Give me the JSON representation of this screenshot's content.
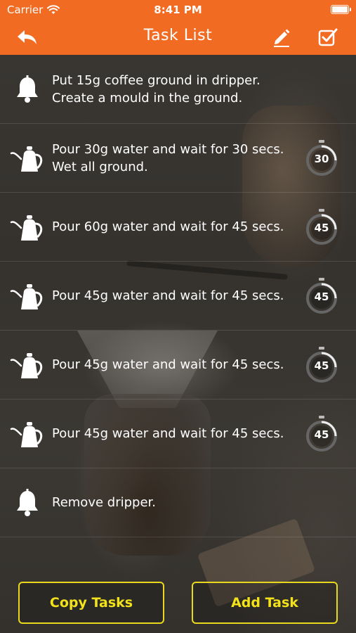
{
  "status_bar": {
    "carrier": "Carrier",
    "time": "8:41 PM"
  },
  "nav": {
    "title": "Task List"
  },
  "tasks": [
    {
      "icon": "bell-icon",
      "text": "Put 15g coffee ground in dripper. Create a mould in the ground.",
      "timer": ""
    },
    {
      "icon": "kettle-icon",
      "text": "Pour 30g water and wait for 30 secs. Wet all ground.",
      "timer": "30"
    },
    {
      "icon": "kettle-icon",
      "text": "Pour 60g water and wait for 45 secs.",
      "timer": "45"
    },
    {
      "icon": "kettle-icon",
      "text": "Pour 45g water and wait for 45 secs.",
      "timer": "45"
    },
    {
      "icon": "kettle-icon",
      "text": "Pour 45g water and wait for 45 secs.",
      "timer": "45"
    },
    {
      "icon": "kettle-icon",
      "text": "Pour 45g water and wait for 45 secs.",
      "timer": "45"
    },
    {
      "icon": "bell-icon",
      "text": "Remove dripper.",
      "timer": ""
    }
  ],
  "buttons": {
    "copy": "Copy Tasks",
    "add": "Add Task"
  },
  "colors": {
    "accent": "#f26b22",
    "button_border": "#e8d81e",
    "button_text": "#f2e21a"
  }
}
